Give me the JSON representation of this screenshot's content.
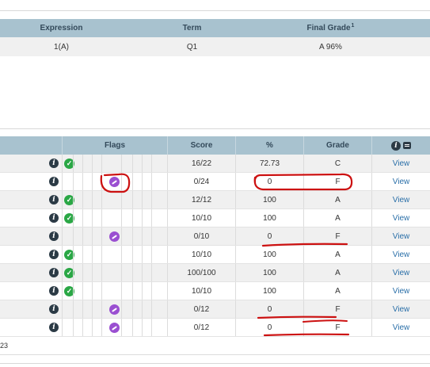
{
  "summary": {
    "headers": {
      "expression": "Expression",
      "term": "Term",
      "final_grade": "Final Grade",
      "final_grade_sup": "1"
    },
    "row": {
      "expression": "1(A)",
      "term": "Q1",
      "final_grade": "A  96%"
    }
  },
  "assignments": {
    "headers": {
      "flags": "Flags",
      "score": "Score",
      "percent": "%",
      "grade": "Grade"
    },
    "rows": [
      {
        "score": "16/22",
        "percent": "72.73",
        "grade": "C",
        "action": "View",
        "completed": true,
        "excused": false
      },
      {
        "score": "0/24",
        "percent": "0",
        "grade": "F",
        "action": "View",
        "completed": false,
        "excused": true
      },
      {
        "score": "12/12",
        "percent": "100",
        "grade": "A",
        "action": "View",
        "completed": true,
        "excused": false
      },
      {
        "score": "10/10",
        "percent": "100",
        "grade": "A",
        "action": "View",
        "completed": true,
        "excused": false
      },
      {
        "score": "0/10",
        "percent": "0",
        "grade": "F",
        "action": "View",
        "completed": false,
        "excused": true
      },
      {
        "score": "10/10",
        "percent": "100",
        "grade": "A",
        "action": "View",
        "completed": true,
        "excused": false
      },
      {
        "score": "100/100",
        "percent": "100",
        "grade": "A",
        "action": "View",
        "completed": true,
        "excused": false
      },
      {
        "score": "10/10",
        "percent": "100",
        "grade": "A",
        "action": "View",
        "completed": true,
        "excused": false
      },
      {
        "score": "0/12",
        "percent": "0",
        "grade": "F",
        "action": "View",
        "completed": false,
        "excused": true
      },
      {
        "score": "0/12",
        "percent": "0",
        "grade": "F",
        "action": "View",
        "completed": false,
        "excused": true
      }
    ],
    "footer_text": "23"
  },
  "icons": {
    "info": "info-icon",
    "completed": "check-circle-icon",
    "excused": "excused-flag-icon",
    "comment": "comment-icon"
  },
  "colors": {
    "header_bg": "#a8c2cf",
    "alt_row": "#f0f0f0",
    "check": "#2aa745",
    "excused": "#9a4fd1",
    "link": "#2a6fa8",
    "annotation": "#cc1111"
  }
}
